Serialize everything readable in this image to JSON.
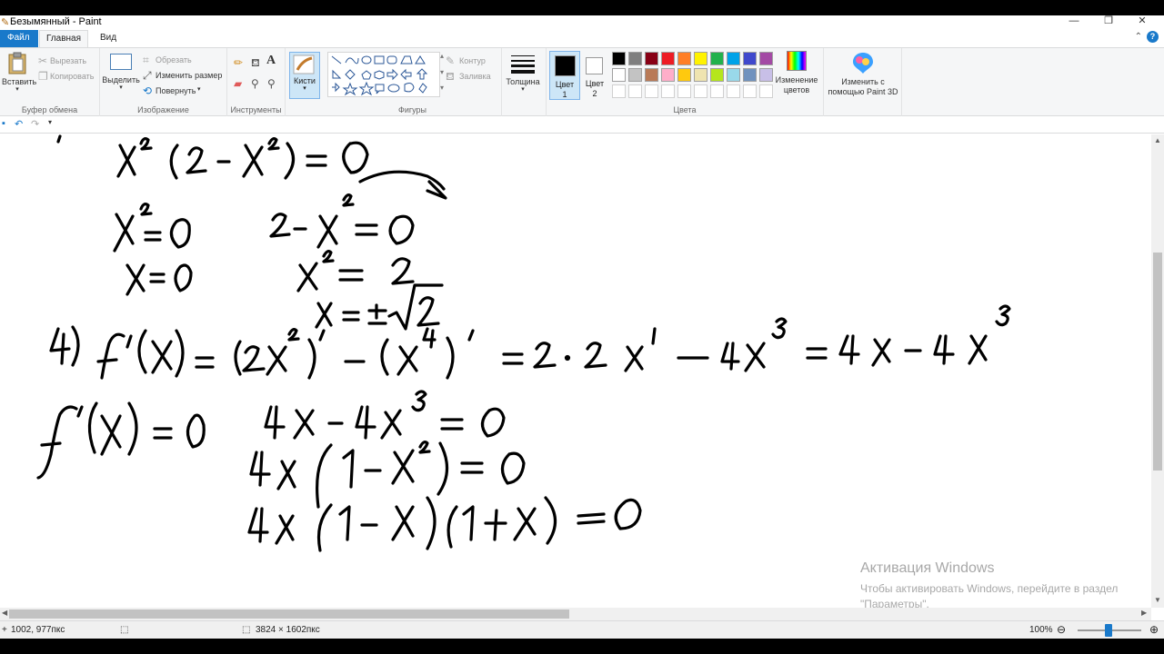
{
  "window": {
    "title": "Безымянный - Paint",
    "minimize": "—",
    "restore": "❐",
    "close": "✕"
  },
  "tabs": {
    "file": "Файл",
    "home": "Главная",
    "view": "Вид"
  },
  "clipboard": {
    "paste": "Вставить",
    "cut": "Вырезать",
    "copy": "Копировать",
    "group": "Буфер обмена"
  },
  "image": {
    "select": "Выделить",
    "crop": "Обрезать",
    "resize": "Изменить размер",
    "rotate": "Повернуть",
    "group": "Изображение"
  },
  "tools": {
    "group": "Инструменты"
  },
  "brushes": {
    "label": "Кисти"
  },
  "shapes": {
    "outline": "Контур",
    "fill": "Заливка",
    "group": "Фигуры"
  },
  "size": {
    "label": "Толщина"
  },
  "colors": {
    "color1": "Цвет 1",
    "color2": "Цвет 2",
    "edit": "Изменение цветов",
    "paint3d": "Изменить с помощью Paint 3D",
    "group": "Цвета",
    "palette_row1": [
      "#000000",
      "#7f7f7f",
      "#880015",
      "#ed1c24",
      "#ff7f27",
      "#fff200",
      "#22b14c",
      "#00a2e8",
      "#3f48cc",
      "#a349a4"
    ],
    "palette_row2": [
      "#ffffff",
      "#c3c3c3",
      "#b97a57",
      "#ffaec9",
      "#ffc90e",
      "#efe4b0",
      "#b5e61d",
      "#99d9ea",
      "#7092be",
      "#c8bfe7"
    ],
    "current1": "#000000",
    "current2": "#ffffff"
  },
  "watermark": {
    "title": "Активация Windows",
    "line1": "Чтобы активировать Windows, перейдите в раздел",
    "line2": "\"Параметры\"."
  },
  "status": {
    "cursor": "1002, 977пкс",
    "size": "3824 × 1602пкс",
    "zoom": "100%"
  }
}
